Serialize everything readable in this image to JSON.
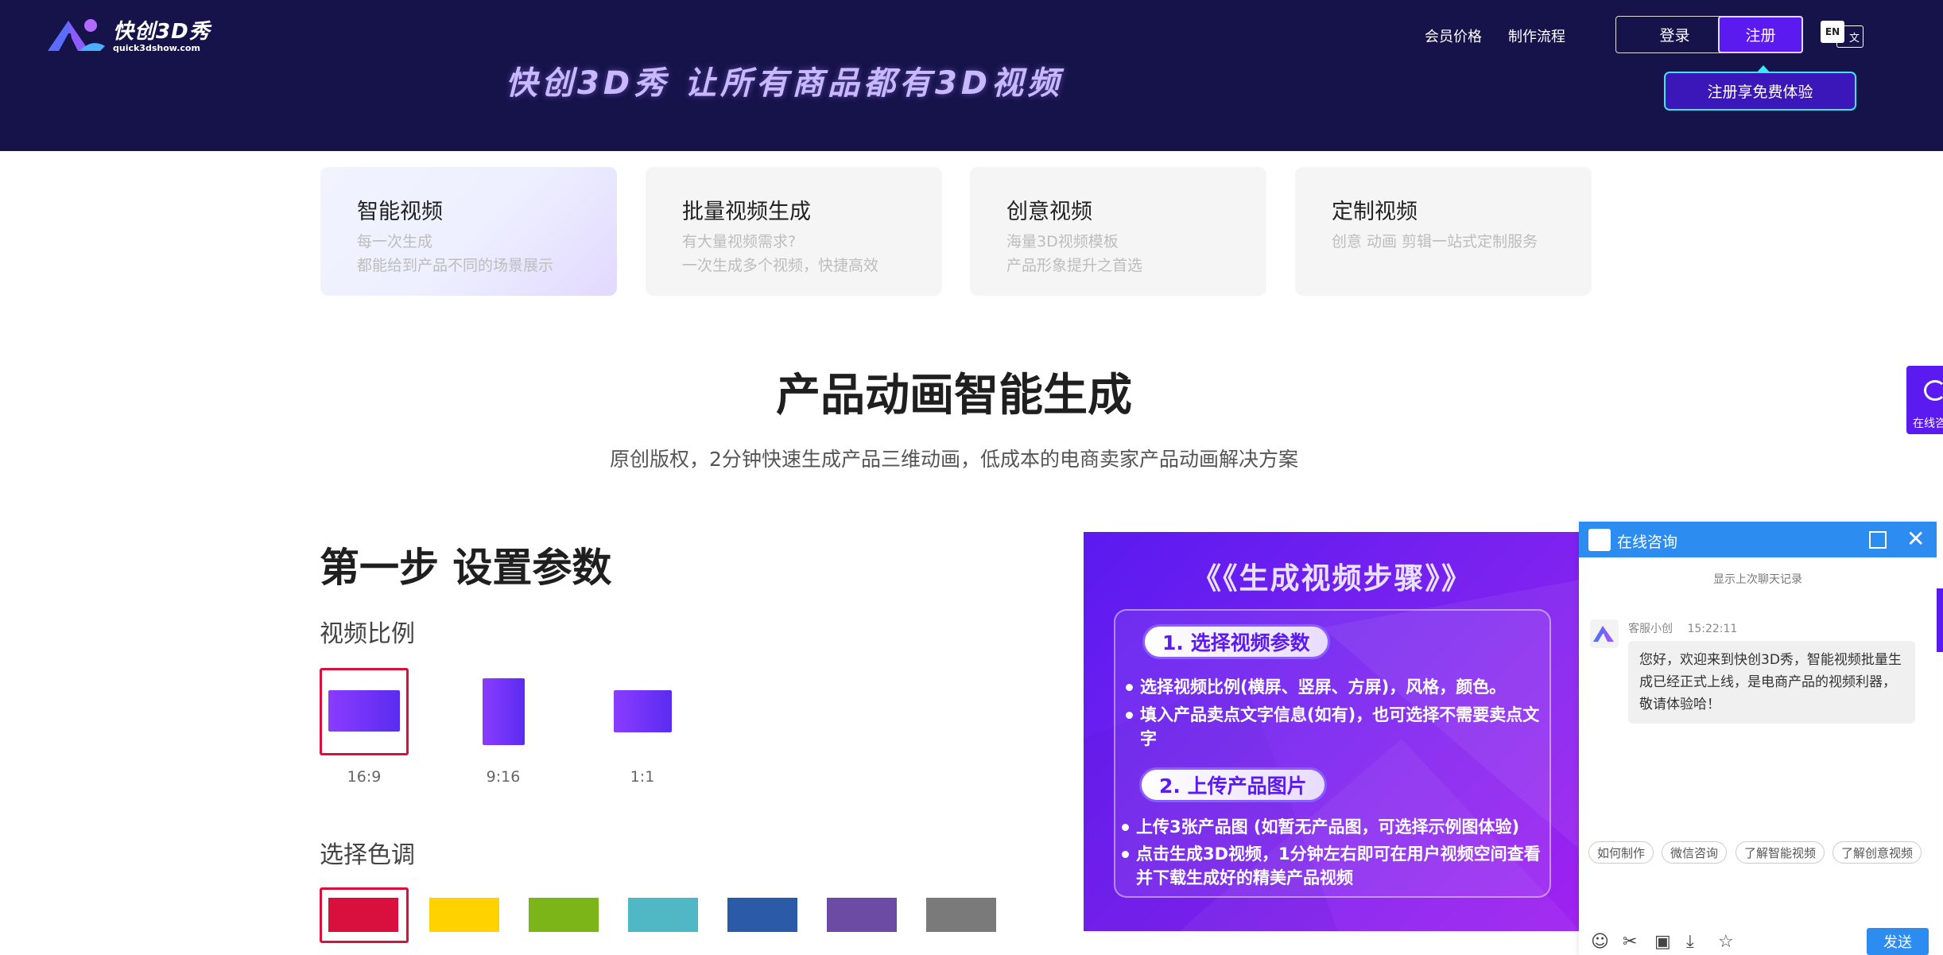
{
  "header": {
    "logo_cn": "快创3D秀",
    "logo_en": "quick3dshow.com",
    "slogan": "快创3D秀  让所有商品都有3D视频",
    "nav": [
      "会员价格",
      "制作流程"
    ],
    "login_label": "登录",
    "register_label": "注册",
    "lang_en": "EN",
    "lang_cn": "文",
    "free_trial_label": "注册享免费体验"
  },
  "cards": [
    {
      "title": "智能视频",
      "lines": [
        "每一次生成",
        "都能给到产品不同的场景展示"
      ]
    },
    {
      "title": "批量视频生成",
      "lines": [
        "有大量视频需求?",
        "一次生成多个视频，快捷高效"
      ]
    },
    {
      "title": "创意视频",
      "lines": [
        "海量3D视频模板",
        "产品形象提升之首选"
      ]
    },
    {
      "title": "定制视频",
      "lines": [
        "创意 动画 剪辑一站式定制服务"
      ]
    }
  ],
  "main": {
    "headline": "产品动画智能生成",
    "subline": "原创版权，2分钟快速生成产品三维动画，低成本的电商卖家产品动画解决方案",
    "step_title": "第一步 设置参数",
    "ratio_label": "视频比例",
    "ratios": [
      "16:9",
      "9:16",
      "1:1"
    ],
    "color_label": "选择色调",
    "swatches": [
      "#d9103e",
      "#ffd200",
      "#7cb518",
      "#4fb8c4",
      "#2b5ba8",
      "#6b4ba3",
      "#7a7a7a"
    ]
  },
  "promo": {
    "title": "《《生成视频步骤》》",
    "step1": "1. 选择视频参数",
    "step1_bullets": [
      "选择视频比例(横屏、竖屏、方屏)，风格，颜色。",
      "填入产品卖点文字信息(如有)，也可选择不需要卖点文字"
    ],
    "step2": "2. 上传产品图片",
    "step2_bullets": [
      "上传3张产品图 (如暂无产品图，可选择示例图体验)",
      "点击生成3D视频，1分钟左右即可在用户视频空间查看并下载生成好的精美产品视频"
    ]
  },
  "float_tab": {
    "label": "在线咨"
  },
  "chat": {
    "title": "在线咨询",
    "history": "显示上次聊天记录",
    "agent_name": "客服小创",
    "time": "15:22:11",
    "message": "您好，欢迎来到快创3D秀，智能视频批量生成已经正式上线，是电商产品的视频利器，敬请体验哈！",
    "quick_replies": [
      "如何制作",
      "微信咨询",
      "了解智能视频",
      "了解创意视频"
    ],
    "send_label": "发送"
  }
}
